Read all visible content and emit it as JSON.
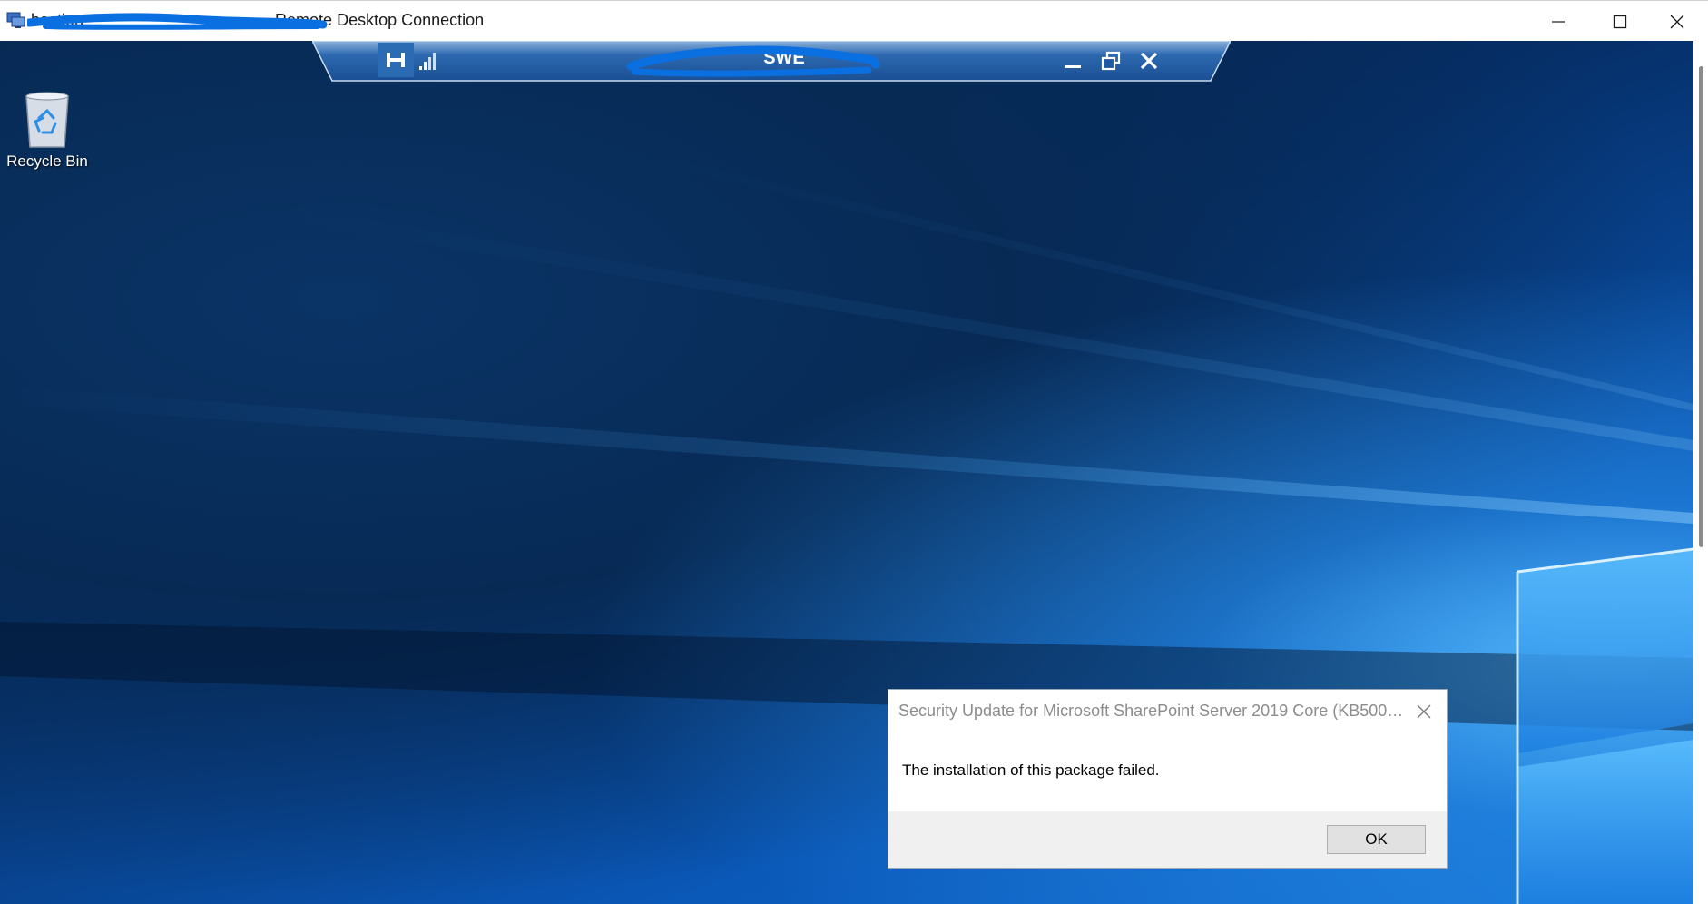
{
  "window": {
    "title_visible": "bastion",
    "title_suffix": "- Remote Desktop Connection",
    "minimize_icon": "minimize-icon",
    "maximize_icon": "maximize-icon",
    "close_icon": "close-icon"
  },
  "connection_bar": {
    "host_label": "SWE",
    "pin_icon": "pin-icon",
    "signal_icon": "signal-strength-icon",
    "minimize_icon": "minimize-icon",
    "restore_icon": "restore-icon",
    "close_icon": "close-icon"
  },
  "desktop": {
    "icons": [
      {
        "label": "Recycle Bin",
        "icon": "recycle-bin-icon"
      }
    ]
  },
  "dialog": {
    "title": "Security Update for Microsoft SharePoint Server 2019 Core (KB5002...",
    "message": "The installation of this package failed.",
    "ok_label": "OK",
    "close_icon": "close-icon"
  },
  "colors": {
    "desktop_dark": "#03142e",
    "desktop_light": "#1777d9",
    "connbar": "#1f5aa0",
    "redaction": "#0a6fe0"
  }
}
